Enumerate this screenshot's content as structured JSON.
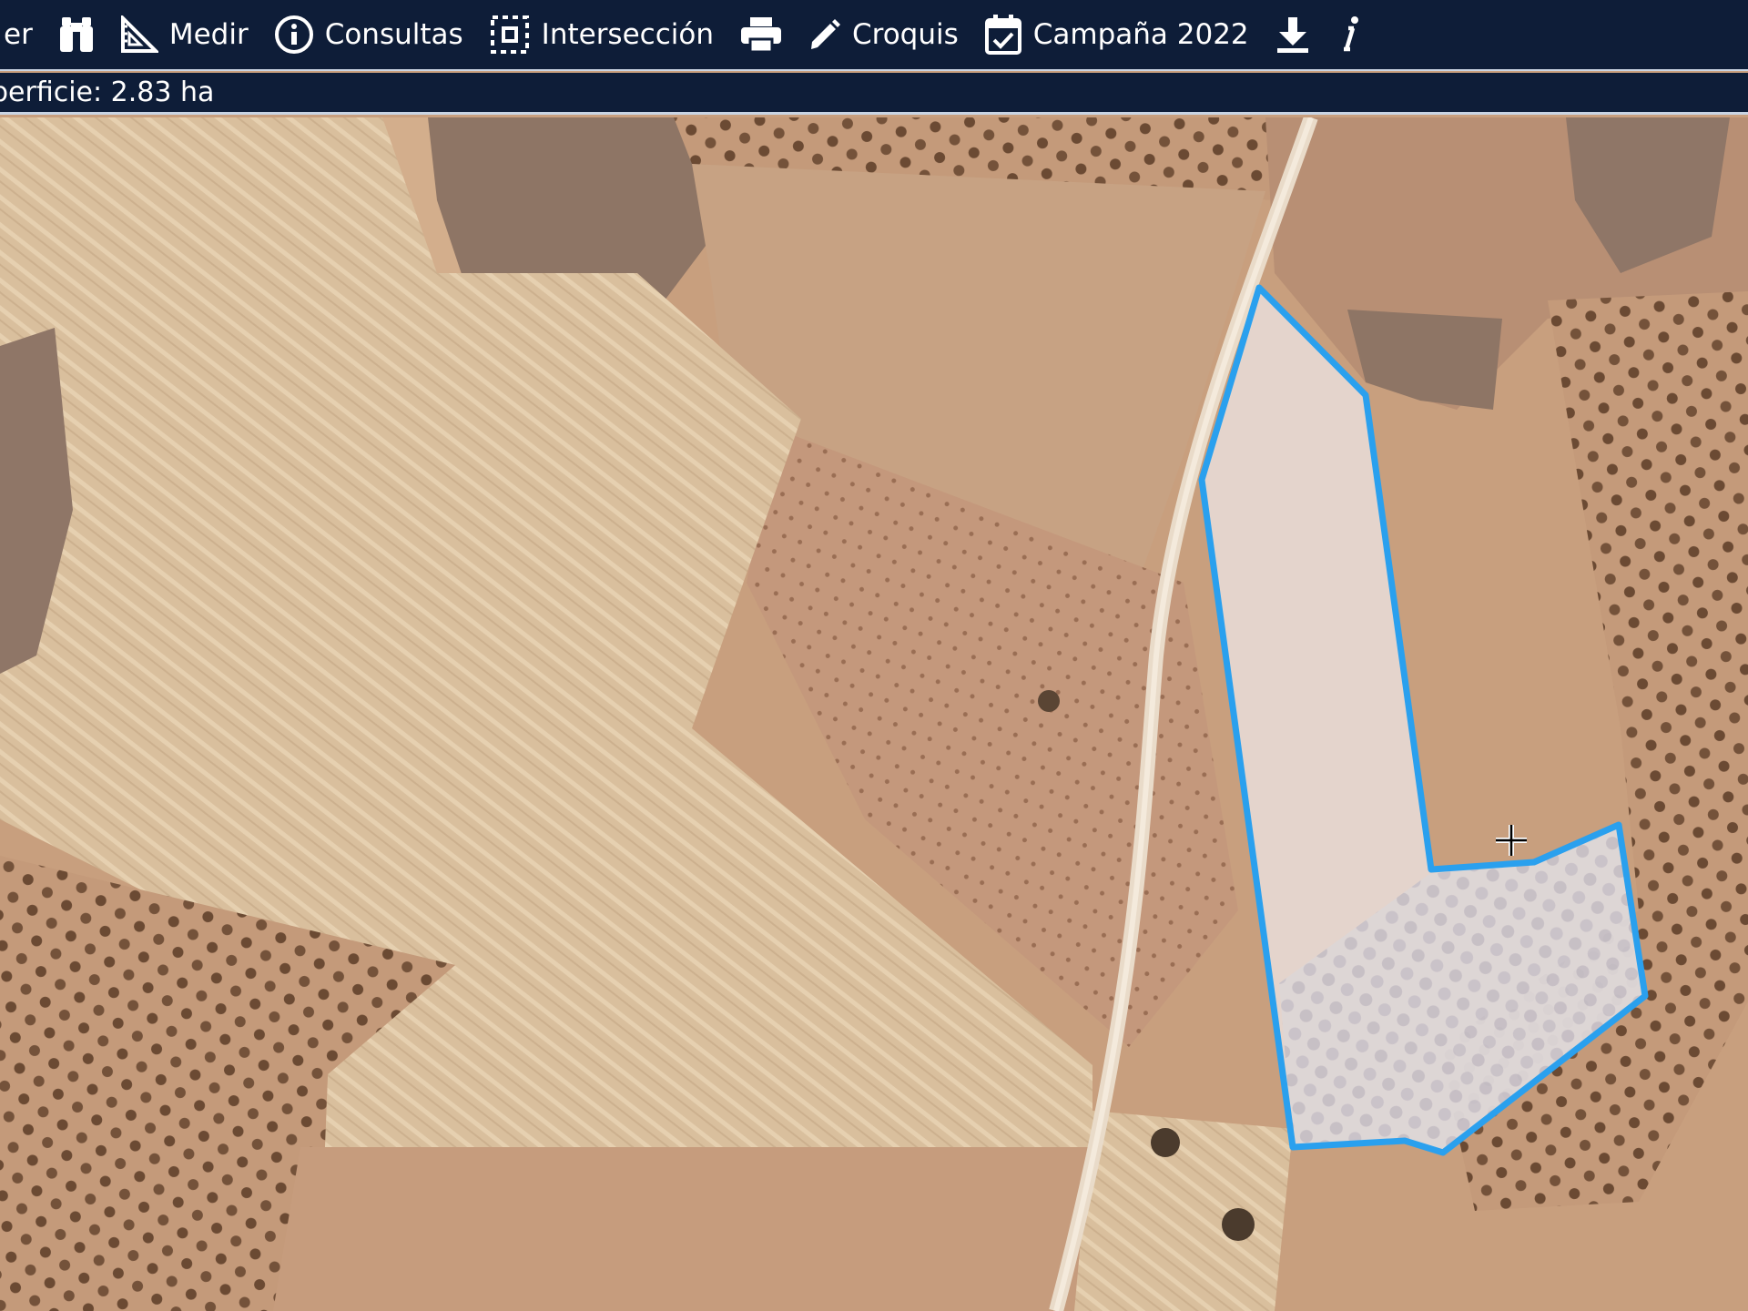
{
  "toolbar": {
    "items": [
      {
        "label": "er",
        "icon": "layers-icon"
      },
      {
        "label": "",
        "icon": "binoculars-icon"
      },
      {
        "label": "Medir",
        "icon": "ruler-triangle-icon"
      },
      {
        "label": "Consultas",
        "icon": "info-circle-icon"
      },
      {
        "label": "Intersección",
        "icon": "intersection-icon"
      },
      {
        "label": "",
        "icon": "printer-icon"
      },
      {
        "label": "Croquis",
        "icon": "pencil-icon"
      },
      {
        "label": "Campaña 2022",
        "icon": "calendar-check-icon"
      },
      {
        "label": "",
        "icon": "download-icon"
      },
      {
        "label": "",
        "icon": "info-italic-icon"
      }
    ]
  },
  "info": {
    "area_text": "perficie: 2.83 ha"
  },
  "map": {
    "view": "satellite",
    "parcel_outline_color": "#2aa0ee",
    "cursor": "crosshair-move"
  },
  "colors": {
    "toolbar_bg": "#0e1d38",
    "toolbar_text": "#ffffff",
    "selection": "#2aa0ee"
  }
}
